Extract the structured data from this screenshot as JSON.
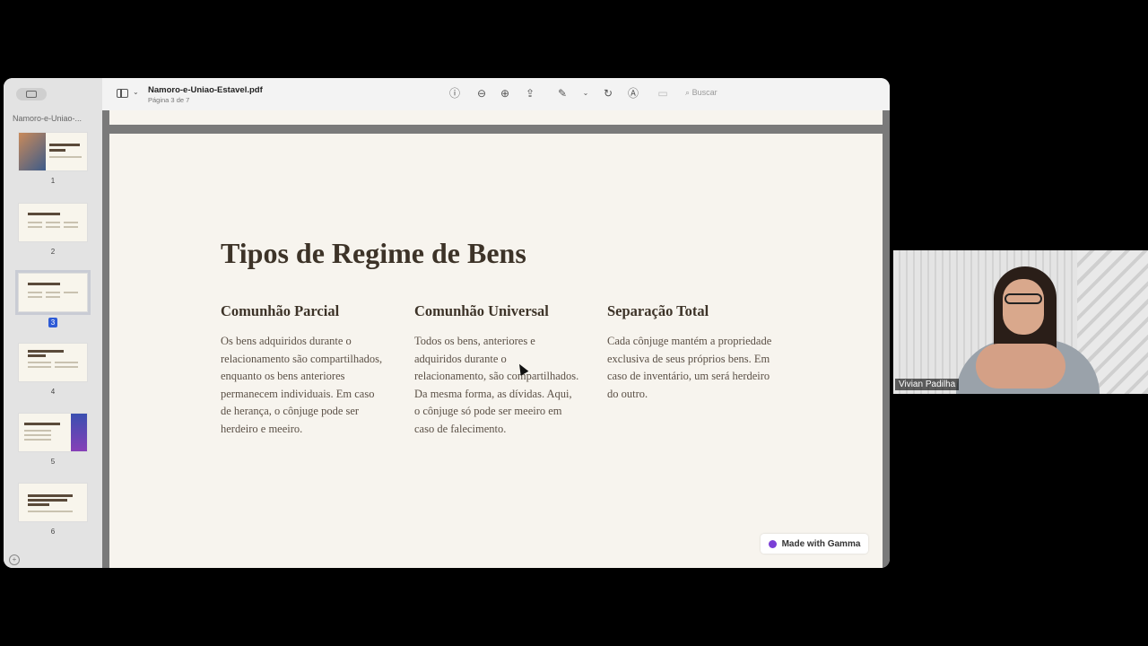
{
  "toolbar": {
    "doc_title": "Namoro-e-Uniao-Estavel.pdf",
    "page_info": "Página 3 de 7",
    "search_placeholder": "Buscar"
  },
  "sidebar": {
    "title": "Namoro-e-Uniao-...",
    "pages": [
      "1",
      "2",
      "3",
      "4",
      "5",
      "6"
    ],
    "selected_page": "3"
  },
  "slide": {
    "title": "Tipos de Regime de Bens",
    "columns": [
      {
        "heading": "Comunhão Parcial",
        "text": "Os bens adquiridos durante o relacionamento são compartilhados, enquanto os bens anteriores permanecem individuais. Em caso de herança, o cônjuge pode ser herdeiro e meeiro."
      },
      {
        "heading": "Comunhão Universal",
        "text": "Todos os bens, anteriores e adquiridos durante o relacionamento, são compartilhados. Da mesma forma, as dívidas. Aqui, o cônjuge só pode ser meeiro em caso de falecimento."
      },
      {
        "heading": "Separação Total",
        "text": "Cada cônjuge mantém a propriedade exclusiva de seus próprios bens. Em caso de inventário, um será herdeiro do outro."
      }
    ],
    "badge": "Made with Gamma"
  },
  "video": {
    "participant_name": "Vivian Padilha"
  }
}
